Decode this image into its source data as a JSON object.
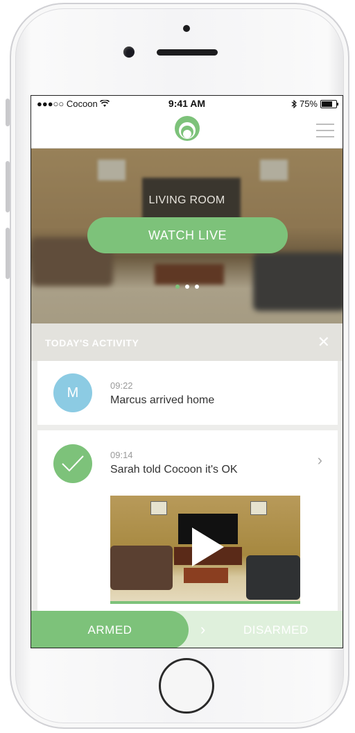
{
  "status_bar": {
    "carrier": "●●●○○ Cocoon",
    "wifi_icon": "wifi-icon",
    "time": "9:41 AM",
    "bluetooth_icon": "bluetooth-icon",
    "battery": "75%"
  },
  "nav": {
    "logo_icon": "cocoon-logo-icon",
    "menu_icon": "hamburger-menu-icon"
  },
  "hero": {
    "room_label": "LIVING ROOM",
    "watch_button": "WATCH LIVE",
    "carousel_pages": 3,
    "carousel_active": 1
  },
  "activity": {
    "title": "TODAY'S ACTIVITY",
    "close_symbol": "✕",
    "items": [
      {
        "avatar": "M",
        "time": "09:22",
        "message": "Marcus arrived home"
      },
      {
        "time": "09:14",
        "message": "Sarah told Cocoon it's OK",
        "chevron": "›"
      }
    ]
  },
  "toggle": {
    "armed": "ARMED",
    "chevron": "›",
    "disarmed": "DISARMED"
  },
  "colors": {
    "accent": "#7dc27a",
    "avatar_blue": "#8ccbe3"
  }
}
